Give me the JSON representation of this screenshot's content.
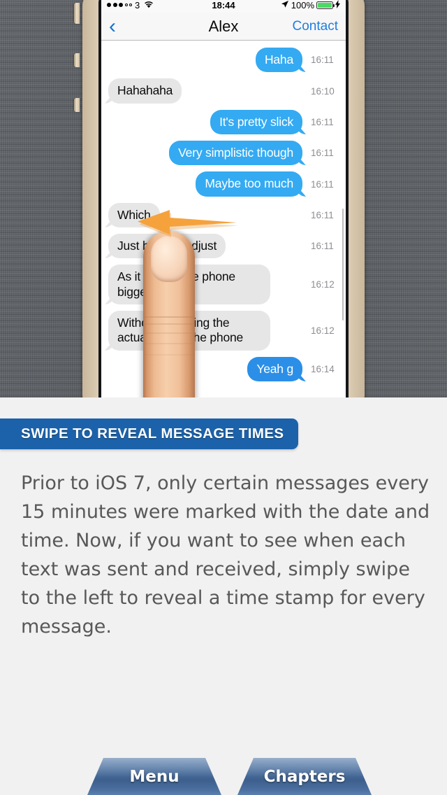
{
  "photo": {
    "device": {
      "status_bar": {
        "signal_dots_filled": 3,
        "signal_dots_total": 5,
        "carrier": "3",
        "wifi_icon": "wifi-icon",
        "time": "18:44",
        "location_icon": "location-arrow-icon",
        "battery_percent": "100%",
        "battery_icon": "battery-full-icon",
        "charging_icon": "lightning-bolt-icon"
      },
      "nav_bar": {
        "back_icon": "chevron-left-icon",
        "title": "Alex",
        "right_action": "Contact"
      },
      "conversation": [
        {
          "text": "Haha",
          "side": "out",
          "time": "16:11"
        },
        {
          "text": "Hahahaha",
          "side": "in",
          "time": "16:10"
        },
        {
          "text": "It's pretty slick",
          "side": "out",
          "time": "16:11"
        },
        {
          "text": "Very simplistic though",
          "side": "out",
          "time": "16:11"
        },
        {
          "text": "Maybe too much",
          "side": "out",
          "time": "16:11"
        },
        {
          "text": "Which",
          "side": "in",
          "time": "16:11"
        },
        {
          "text": "Just have to adjust",
          "side": "in",
          "time": "16:11"
        },
        {
          "text": "As it makes the phone bigger",
          "side": "in",
          "time": "16:12"
        },
        {
          "text": "Without changing the actual size of the phone",
          "side": "in",
          "time": "16:12"
        },
        {
          "text": "Yeah g",
          "side": "out",
          "time": "16:14"
        }
      ]
    },
    "annotation": {
      "arrow_icon": "left-pointing-arrow-annotation",
      "arrow_color": "#f3a03a"
    },
    "hand_icon": "finger-swiping-icon"
  },
  "content": {
    "banner": {
      "label": "SWIPE TO REVEAL MESSAGE TIMES",
      "color": "#1b62ab"
    },
    "paragraph": "Prior to iOS 7, only certain messages every 15 minutes were marked with the date and time. Now, if you want to see when each text was sent and received, simply swipe to the left to reveal a time stamp for every message."
  },
  "footer": {
    "menu_label": "Menu",
    "chapters_label": "Chapters"
  }
}
